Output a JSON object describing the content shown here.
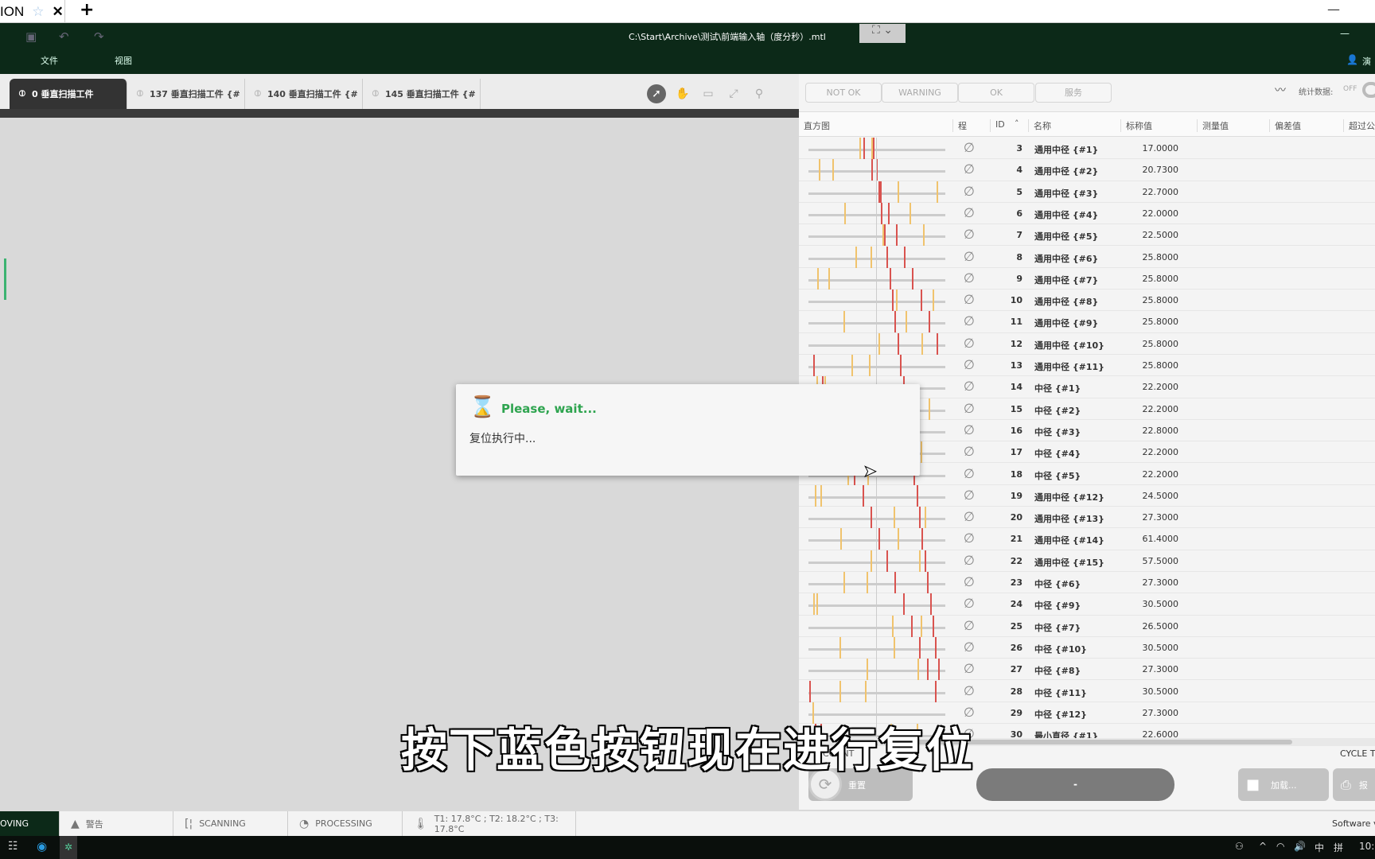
{
  "browser": {
    "tab_title": "ION",
    "new_tab": "+"
  },
  "app": {
    "file_path": "C:\\Start\\Archive\\测试\\前端输入轴（度分秒）.mtl",
    "menu": [
      "文件",
      "视图"
    ],
    "user_label": "演"
  },
  "tabs": [
    "0 垂直扫描工件",
    "137 垂直扫描工件 {#",
    "140 垂直扫描工件 {#",
    "145 垂直扫描工件 {#"
  ],
  "status_buttons": [
    "NOT OK",
    "WARNING",
    "OK",
    "服务"
  ],
  "stats": {
    "label": "统计数据:",
    "toggle": "OFF"
  },
  "columns": {
    "histogram": "直方图",
    "process": "程",
    "id": "ID",
    "name": "名称",
    "nominal": "标称值",
    "measured": "测量值",
    "deviation": "偏差值",
    "exceed": "超过公"
  },
  "rows": [
    {
      "id": "3",
      "name": "通用中径 {#1}",
      "nominal": "17.0000"
    },
    {
      "id": "4",
      "name": "通用中径 {#2}",
      "nominal": "20.7300"
    },
    {
      "id": "5",
      "name": "通用中径 {#3}",
      "nominal": "22.7000"
    },
    {
      "id": "6",
      "name": "通用中径 {#4}",
      "nominal": "22.0000"
    },
    {
      "id": "7",
      "name": "通用中径 {#5}",
      "nominal": "22.5000"
    },
    {
      "id": "8",
      "name": "通用中径 {#6}",
      "nominal": "25.8000"
    },
    {
      "id": "9",
      "name": "通用中径 {#7}",
      "nominal": "25.8000"
    },
    {
      "id": "10",
      "name": "通用中径 {#8}",
      "nominal": "25.8000"
    },
    {
      "id": "11",
      "name": "通用中径 {#9}",
      "nominal": "25.8000"
    },
    {
      "id": "12",
      "name": "通用中径 {#10}",
      "nominal": "25.8000"
    },
    {
      "id": "13",
      "name": "通用中径 {#11}",
      "nominal": "25.8000"
    },
    {
      "id": "14",
      "name": "中径 {#1}",
      "nominal": "22.2000"
    },
    {
      "id": "15",
      "name": "中径 {#2}",
      "nominal": "22.2000"
    },
    {
      "id": "16",
      "name": "中径 {#3}",
      "nominal": "22.8000"
    },
    {
      "id": "17",
      "name": "中径 {#4}",
      "nominal": "22.2000"
    },
    {
      "id": "18",
      "name": "中径 {#5}",
      "nominal": "22.2000"
    },
    {
      "id": "19",
      "name": "通用中径 {#12}",
      "nominal": "24.5000"
    },
    {
      "id": "20",
      "name": "通用中径 {#13}",
      "nominal": "27.3000"
    },
    {
      "id": "21",
      "name": "通用中径 {#14}",
      "nominal": "61.4000"
    },
    {
      "id": "22",
      "name": "通用中径 {#15}",
      "nominal": "57.5000"
    },
    {
      "id": "23",
      "name": "中径 {#6}",
      "nominal": "27.3000"
    },
    {
      "id": "24",
      "name": "中径 {#9}",
      "nominal": "30.5000"
    },
    {
      "id": "25",
      "name": "中径 {#7}",
      "nominal": "26.5000"
    },
    {
      "id": "26",
      "name": "中径 {#10}",
      "nominal": "30.5000"
    },
    {
      "id": "27",
      "name": "中径 {#8}",
      "nominal": "27.3000"
    },
    {
      "id": "28",
      "name": "中径 {#11}",
      "nominal": "30.5000"
    },
    {
      "id": "29",
      "name": "中径 {#12}",
      "nominal": "27.3000"
    },
    {
      "id": "30",
      "name": "最小直径 {#1}",
      "nominal": "22.6000"
    }
  ],
  "bottom": {
    "count_label": "COUNT",
    "cycle_label": "CYCLE T",
    "reset_label": "重置",
    "main_button": "-",
    "load_label": "加载...",
    "print_label": "报",
    "software_label": "Software v"
  },
  "dialog": {
    "title": "Please, wait...",
    "message": "复位执行中..."
  },
  "subtitle": "按下蓝色按钮现在进行复位",
  "statusbar": {
    "mode": "OVING",
    "warning": "警告",
    "scanning": "SCANNING",
    "processing": "PROCESSING",
    "temps": "T1: 17.8°C ; T2: 18.2°C ; T3: 17.8°C"
  },
  "taskbar": {
    "ime1": "中",
    "ime2": "拼",
    "clock": "10:"
  },
  "colors": {
    "header": "#0c2918",
    "accent": "#2ea44f",
    "red": "#d9534f",
    "yellow": "#f0c36d"
  }
}
